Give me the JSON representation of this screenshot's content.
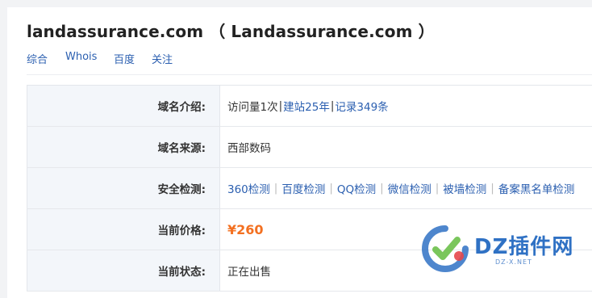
{
  "title": "landassurance.com （ Landassurance.com ）",
  "tabs": [
    "综合",
    "Whois",
    "百度",
    "关注"
  ],
  "rows": {
    "intro": {
      "label": "域名介绍:",
      "visits": "访问量1次",
      "sep": "|",
      "build": "建站25年",
      "records": "记录349条"
    },
    "source": {
      "label": "域名来源:",
      "value": "西部数码"
    },
    "security": {
      "label": "安全检测:",
      "links": [
        "360检测",
        "百度检测",
        "QQ检测",
        "微信检测",
        "被墙检测",
        "备案黑名单检测"
      ],
      "sep": "|"
    },
    "price": {
      "label": "当前价格:",
      "value": "¥260"
    },
    "status": {
      "label": "当前状态:",
      "value": "正在出售"
    }
  },
  "watermark": {
    "brand": "DZ插件网",
    "sub": "DZ-X.NET"
  },
  "colors": {
    "link": "#2b5fb0",
    "price": "#f37021",
    "label_bg": "#f3f6fa",
    "watermark_blue": "#2f71c4",
    "watermark_green": "#6cc04a"
  }
}
